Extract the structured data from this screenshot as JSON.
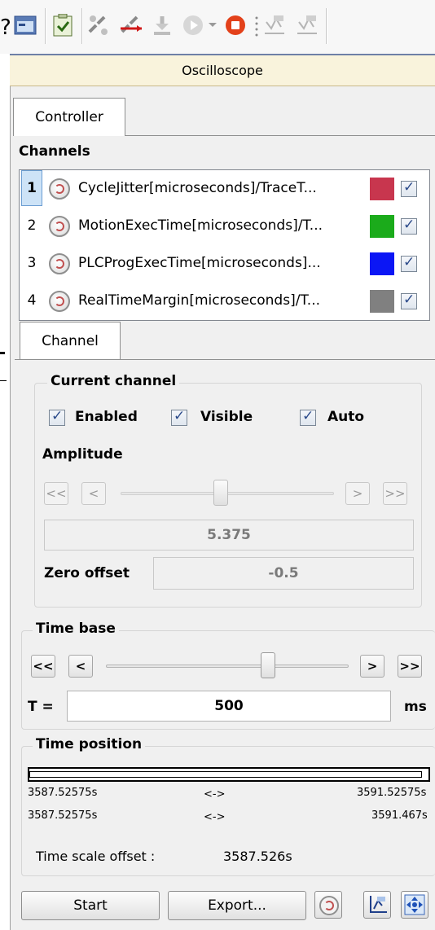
{
  "toolbar": {
    "items": [
      "new-scope-icon",
      "panel-icon",
      "check-icon",
      "link-icon",
      "unlink-icon",
      "download-icon",
      "play-icon",
      "dropdown-icon",
      "stop-icon",
      "trace-icon",
      "trace-icon-2"
    ]
  },
  "osc": {
    "title": "Oscilloscope"
  },
  "tabs": {
    "controller": "Controller",
    "channel": "Channel"
  },
  "channels": {
    "heading": "Channels",
    "rows": [
      {
        "num": "1",
        "name": "CycleJitter[microseconds]/TraceT...",
        "color": "#c8364e",
        "selected": true
      },
      {
        "num": "2",
        "name": "MotionExecTime[microseconds]/T...",
        "color": "#1bab1b",
        "selected": false
      },
      {
        "num": "3",
        "name": "PLCProgExecTime[microseconds]...",
        "color": "#0b16f5",
        "selected": false
      },
      {
        "num": "4",
        "name": "RealTimeMargin[microseconds]/T...",
        "color": "#808080",
        "selected": false
      }
    ]
  },
  "current_channel": {
    "title": "Current channel",
    "enabled": "Enabled",
    "visible": "Visible",
    "auto": "Auto",
    "amplitude_label": "Amplitude",
    "btn_first": "<<",
    "btn_prev": "<",
    "btn_next": ">",
    "btn_last": ">>",
    "amplitude_value": "5.375",
    "zero_offset_label": "Zero offset",
    "zero_offset_value": "-0.5"
  },
  "time_base": {
    "title": "Time base",
    "btn_first": "<<",
    "btn_prev": "<",
    "btn_next": ">",
    "btn_last": ">>",
    "t_label": "T =",
    "t_value": "500",
    "unit": "ms"
  },
  "time_position": {
    "title": "Time position",
    "row1_left": "3587.52575s",
    "row1_mid": "<->",
    "row1_right": "3591.52575s",
    "row2_left": "3587.52575s",
    "row2_mid": "<->",
    "row2_right": "3591.467s",
    "offset_label": "Time scale offset :",
    "offset_value": "3587.526s"
  },
  "footer": {
    "start": "Start",
    "export": "Export..."
  },
  "colors": {
    "accent_bar": "#f9f3dc",
    "panel": "#f0f0f0"
  }
}
